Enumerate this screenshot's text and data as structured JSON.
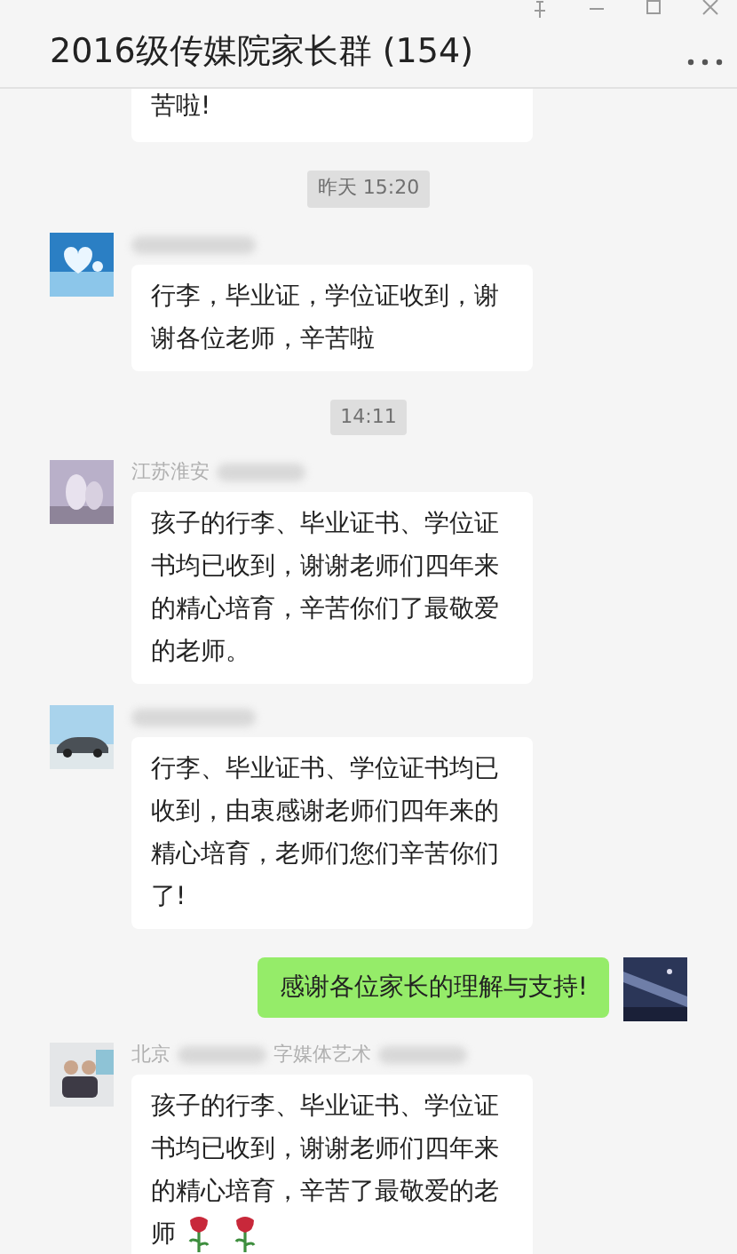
{
  "window": {
    "title": "2016级传媒院家长群 (154)"
  },
  "messages": [
    {
      "kind": "received",
      "text": "苦啦!"
    },
    {
      "kind": "time",
      "text": "昨天 15:20"
    },
    {
      "kind": "received",
      "avatar": {
        "kind": "picture"
      },
      "text": "行李，毕业证，学位证收到，谢谢各位老师，辛苦啦"
    },
    {
      "kind": "time",
      "text": "14:11"
    },
    {
      "kind": "received",
      "avatar": {
        "kind": "picture"
      },
      "name_parts": [
        "江苏淮安"
      ],
      "text": "孩子的行李、毕业证书、学位证书均已收到，谢谢老师们四年来的精心培育，辛苦你们了最敬爱的老师。"
    },
    {
      "kind": "received",
      "avatar": {
        "kind": "picture"
      },
      "text": "行李、毕业证书、学位证书均已收到，由衷感谢老师们四年来的精心培育，老师们您们辛苦你们了!"
    },
    {
      "kind": "sent",
      "avatar": {
        "kind": "picture"
      },
      "text": "感谢各位家长的理解与支持!"
    },
    {
      "kind": "received",
      "avatar": {
        "kind": "picture"
      },
      "name_parts": [
        "北京",
        "字媒体艺术"
      ],
      "text": "孩子的行李、毕业证书、学位证书均已收到，谢谢老师们四年来的精心培育，辛苦了最敬爱的老师",
      "trailing": [
        {
          "kind": "rose"
        },
        {
          "kind": "rose"
        }
      ]
    }
  ]
}
